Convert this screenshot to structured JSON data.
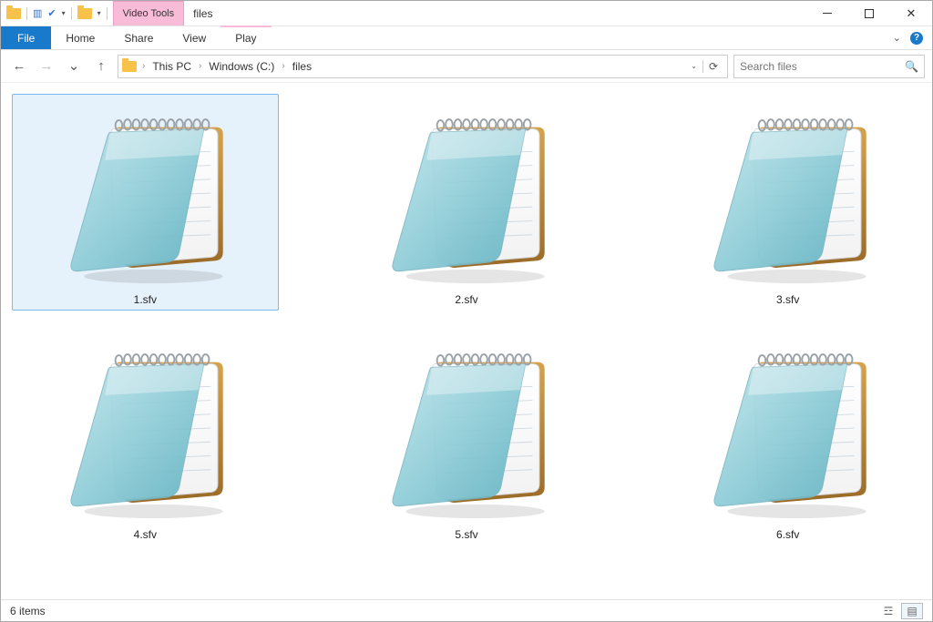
{
  "window": {
    "title": "files",
    "contextual_tools": "Video Tools"
  },
  "ribbon": {
    "file": "File",
    "tabs": [
      "Home",
      "Share",
      "View"
    ],
    "contextual_tab": "Play"
  },
  "breadcrumb": [
    "This PC",
    "Windows (C:)",
    "files"
  ],
  "search": {
    "placeholder": "Search files"
  },
  "files": [
    {
      "name": "1.sfv",
      "selected": true
    },
    {
      "name": "2.sfv",
      "selected": false
    },
    {
      "name": "3.sfv",
      "selected": false
    },
    {
      "name": "4.sfv",
      "selected": false
    },
    {
      "name": "5.sfv",
      "selected": false
    },
    {
      "name": "6.sfv",
      "selected": false
    }
  ],
  "status": {
    "count_label": "6 items"
  },
  "icons": {
    "back": "←",
    "forward": "→",
    "up": "↑",
    "refresh": "⟳",
    "search": "🔍",
    "chevron_down": "⌄",
    "check": "✔"
  }
}
